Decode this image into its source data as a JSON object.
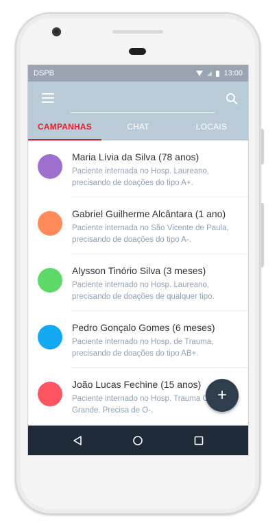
{
  "status_bar": {
    "carrier": "DSPB",
    "time": "13:00"
  },
  "search": {
    "placeholder": ""
  },
  "tabs": [
    {
      "label": "CAMPANHAS",
      "active": true
    },
    {
      "label": "CHAT",
      "active": false
    },
    {
      "label": "LOCAIS",
      "active": false
    }
  ],
  "campaigns": [
    {
      "name": "Maria Lívia da Silva (78 anos)",
      "description": "Paciente internada no Hosp. Laureano, precisando de doações do tipo A+.",
      "avatar_color": "#9f6fcf"
    },
    {
      "name": "Gabriel Guilherme Alcântara (1 ano)",
      "description": "Paciente internada no São Vicente de Paula, precisando de doações do tipo A-.",
      "avatar_color": "#ff8a5a"
    },
    {
      "name": "Alysson Tinório Silva (3 meses)",
      "description": "Paciente internado no Hosp. Laureano, precisando de doações de qualquer tipo.",
      "avatar_color": "#5fd86a"
    },
    {
      "name": "Pedro Gonçalo Gomes (6 meses)",
      "description": "Paciente internado no Hosp. de Trauma, precisando de doações do tipo AB+.",
      "avatar_color": "#12a9f2"
    },
    {
      "name": "João Lucas Fechine (15 anos)",
      "description": "Paciente internado no Hosp. Trauma Campina Grande. Precisa de O-.",
      "avatar_color": "#ff5563"
    }
  ],
  "fab": {
    "icon": "plus-icon",
    "label": "+"
  },
  "nav_bar": {
    "icons": [
      "back-icon",
      "home-icon",
      "recents-icon"
    ]
  },
  "colors": {
    "accent": "#e0212e",
    "appbar": "#b9cbd7",
    "statusbar": "#9aa5b1",
    "navbar": "#1f2b38",
    "fab": "#2f3e4d"
  }
}
